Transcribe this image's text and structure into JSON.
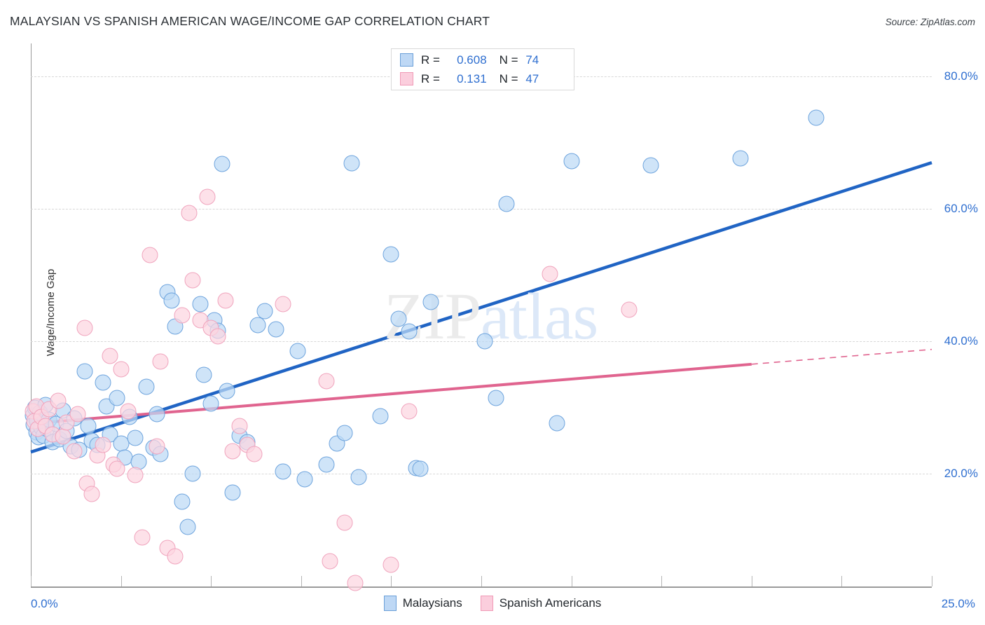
{
  "header": {
    "title": "MALAYSIAN VS SPANISH AMERICAN WAGE/INCOME GAP CORRELATION CHART",
    "source": "Source: ZipAtlas.com"
  },
  "watermark": {
    "part1": "ZIP",
    "part2": "atlas"
  },
  "stat_legend": {
    "rows": [
      {
        "color": "#bed8f5",
        "r_label": "R = ",
        "r_value": "0.608",
        "n_label": "N = ",
        "n_value": "74"
      },
      {
        "color": "#fbcedd",
        "r_label": "R = ",
        "r_value": "0.131",
        "n_label": "N = ",
        "n_value": "47"
      }
    ]
  },
  "series_legend": [
    {
      "name": "Malaysians",
      "color": "#bed8f5"
    },
    {
      "name": "Spanish Americans",
      "color": "#fbcedd"
    }
  ],
  "axes": {
    "y_title": "Wage/Income Gap",
    "y_ticks": [
      "80.0%",
      "60.0%",
      "40.0%",
      "20.0%"
    ],
    "x_min_label": "0.0%",
    "x_max_label": "25.0%"
  },
  "colors": {
    "blue_fill": "#bed8f5",
    "blue_stroke": "#6ea4dd",
    "pink_fill": "#fcd6e1",
    "pink_stroke": "#f0a4bd",
    "blue_line": "#2064c4",
    "pink_line": "#e0648f",
    "tick_text": "#2f6fd0"
  },
  "chart_data": {
    "type": "scatter",
    "title": "MALAYSIAN VS SPANISH AMERICAN WAGE/INCOME GAP CORRELATION CHART",
    "xlabel": "",
    "ylabel": "Wage/Income Gap",
    "xlim": [
      0.0,
      25.0
    ],
    "ylim": [
      3.0,
      85.0
    ],
    "grid": true,
    "xticks": [
      0.0,
      25.0
    ],
    "yticks": [
      20.0,
      40.0,
      60.0,
      80.0
    ],
    "legend_position": "bottom-center",
    "series": [
      {
        "name": "Malaysians",
        "color": "#bed8f5",
        "r": 0.608,
        "n": 74,
        "trendline": {
          "x0": 0.0,
          "y0": 23.3,
          "x1": 25.0,
          "y1": 67.0,
          "style": "solid",
          "color": "#2064c4"
        },
        "points": [
          [
            0.05,
            28.8
          ],
          [
            0.08,
            27.4
          ],
          [
            0.12,
            30.0
          ],
          [
            0.15,
            26.3
          ],
          [
            0.18,
            28.0
          ],
          [
            0.22,
            25.5
          ],
          [
            0.25,
            29.2
          ],
          [
            0.3,
            27.0
          ],
          [
            0.35,
            25.8
          ],
          [
            0.4,
            30.4
          ],
          [
            0.45,
            26.8
          ],
          [
            0.5,
            28.2
          ],
          [
            0.6,
            24.8
          ],
          [
            0.7,
            27.6
          ],
          [
            0.8,
            25.2
          ],
          [
            0.9,
            29.6
          ],
          [
            1.0,
            26.5
          ],
          [
            1.1,
            24.2
          ],
          [
            1.2,
            28.4
          ],
          [
            1.35,
            23.6
          ],
          [
            1.5,
            35.5
          ],
          [
            1.6,
            27.2
          ],
          [
            1.7,
            25.0
          ],
          [
            1.85,
            24.4
          ],
          [
            2.0,
            33.8
          ],
          [
            2.1,
            30.2
          ],
          [
            2.2,
            26.0
          ],
          [
            2.4,
            31.5
          ],
          [
            2.5,
            24.6
          ],
          [
            2.6,
            22.5
          ],
          [
            2.75,
            28.6
          ],
          [
            2.9,
            25.4
          ],
          [
            3.0,
            21.8
          ],
          [
            3.2,
            33.2
          ],
          [
            3.4,
            24.0
          ],
          [
            3.5,
            29.0
          ],
          [
            3.6,
            23.0
          ],
          [
            3.8,
            47.4
          ],
          [
            3.9,
            46.2
          ],
          [
            4.0,
            42.3
          ],
          [
            4.2,
            15.8
          ],
          [
            4.35,
            12.0
          ],
          [
            4.5,
            20.0
          ],
          [
            4.7,
            45.6
          ],
          [
            4.8,
            35.0
          ],
          [
            5.0,
            30.6
          ],
          [
            5.1,
            43.2
          ],
          [
            5.2,
            41.6
          ],
          [
            5.3,
            66.8
          ],
          [
            5.45,
            32.5
          ],
          [
            5.6,
            17.2
          ],
          [
            5.8,
            25.8
          ],
          [
            6.0,
            24.8
          ],
          [
            6.3,
            42.5
          ],
          [
            6.5,
            44.6
          ],
          [
            6.8,
            41.8
          ],
          [
            7.0,
            20.3
          ],
          [
            7.4,
            38.6
          ],
          [
            7.6,
            19.2
          ],
          [
            8.2,
            21.4
          ],
          [
            8.5,
            24.6
          ],
          [
            8.7,
            26.2
          ],
          [
            8.9,
            66.9
          ],
          [
            9.1,
            19.5
          ],
          [
            9.7,
            28.7
          ],
          [
            10.0,
            53.2
          ],
          [
            10.2,
            43.4
          ],
          [
            10.5,
            41.5
          ],
          [
            10.7,
            20.9
          ],
          [
            10.8,
            20.8
          ],
          [
            11.1,
            46.0
          ],
          [
            12.6,
            40.0
          ],
          [
            12.9,
            31.5
          ],
          [
            13.2,
            60.8
          ],
          [
            14.6,
            27.7
          ],
          [
            15.0,
            67.2
          ],
          [
            17.2,
            66.6
          ],
          [
            19.7,
            67.6
          ],
          [
            21.8,
            73.8
          ]
        ]
      },
      {
        "name": "Spanish Americans",
        "color": "#fcd6e1",
        "r": 0.131,
        "n": 47,
        "trendline": {
          "x0": 0.0,
          "y0": 27.6,
          "x1": 25.0,
          "y1": 38.8,
          "style": "solid-then-dashed",
          "dash_from_x": 20.0,
          "color": "#e0648f"
        },
        "points": [
          [
            0.05,
            29.5
          ],
          [
            0.1,
            28.0
          ],
          [
            0.15,
            30.2
          ],
          [
            0.2,
            26.8
          ],
          [
            0.3,
            28.6
          ],
          [
            0.4,
            27.2
          ],
          [
            0.5,
            29.8
          ],
          [
            0.6,
            26.0
          ],
          [
            0.75,
            31.0
          ],
          [
            0.9,
            25.6
          ],
          [
            1.0,
            27.8
          ],
          [
            1.2,
            23.4
          ],
          [
            1.3,
            29.0
          ],
          [
            1.5,
            42.0
          ],
          [
            1.55,
            18.6
          ],
          [
            1.7,
            17.0
          ],
          [
            1.85,
            22.8
          ],
          [
            2.0,
            24.4
          ],
          [
            2.2,
            37.8
          ],
          [
            2.3,
            21.4
          ],
          [
            2.4,
            20.8
          ],
          [
            2.5,
            35.8
          ],
          [
            2.7,
            29.4
          ],
          [
            2.9,
            19.8
          ],
          [
            3.1,
            10.4
          ],
          [
            3.3,
            53.0
          ],
          [
            3.5,
            24.2
          ],
          [
            3.6,
            37.0
          ],
          [
            3.8,
            8.8
          ],
          [
            4.0,
            7.6
          ],
          [
            4.2,
            44.0
          ],
          [
            4.4,
            59.4
          ],
          [
            4.5,
            49.2
          ],
          [
            4.7,
            43.2
          ],
          [
            4.9,
            61.8
          ],
          [
            5.0,
            42.0
          ],
          [
            5.2,
            40.8
          ],
          [
            5.4,
            46.2
          ],
          [
            5.6,
            23.4
          ],
          [
            5.8,
            27.2
          ],
          [
            6.0,
            24.4
          ],
          [
            6.2,
            23.0
          ],
          [
            7.0,
            45.6
          ],
          [
            8.2,
            34.0
          ],
          [
            8.7,
            12.6
          ],
          [
            8.3,
            6.8
          ],
          [
            9.0,
            3.5
          ],
          [
            10.0,
            6.3
          ],
          [
            10.5,
            29.4
          ],
          [
            14.4,
            50.2
          ],
          [
            16.6,
            44.8
          ]
        ]
      }
    ]
  }
}
